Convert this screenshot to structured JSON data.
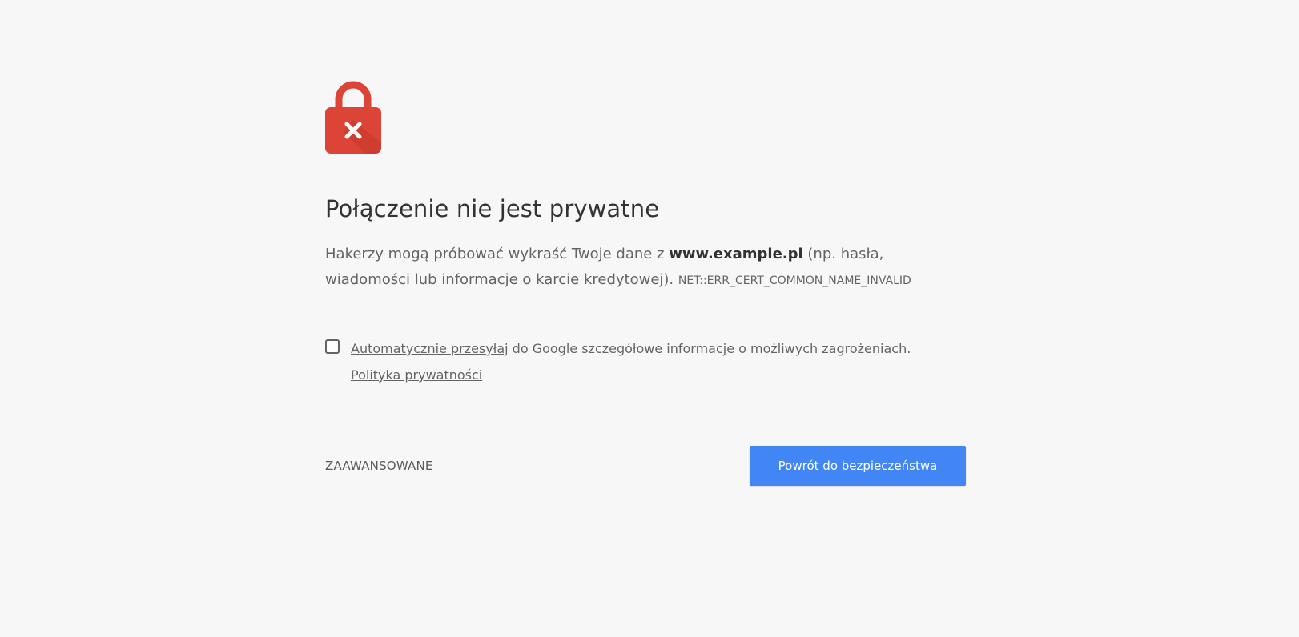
{
  "colors": {
    "background": "#f7f7f7",
    "lock_red": "#db4437",
    "primary_button": "#4285f4"
  },
  "icon": "lock-error-icon",
  "heading": "Połączenie nie jest prywatne",
  "explanation": {
    "part1": "Hakerzy mogą próbować wykraść Twoje dane z ",
    "domain": "www.example.pl",
    "part2": " (np. hasła, wiadomości lub informacje o karcie kredytowej). ",
    "error_code": "NET::ERR_CERT_COMMON_NAME_INVALID"
  },
  "reporting": {
    "checked": false,
    "link1": "Automatycznie przesyłaj",
    "text": " do Google szczegółowe informacje o możliwych zagrożeniach. ",
    "link2": "Polityka prywatności"
  },
  "nav": {
    "details_label": "ZAAWANSOWANE",
    "primary_label": "Powrót do bezpieczeństwa"
  }
}
